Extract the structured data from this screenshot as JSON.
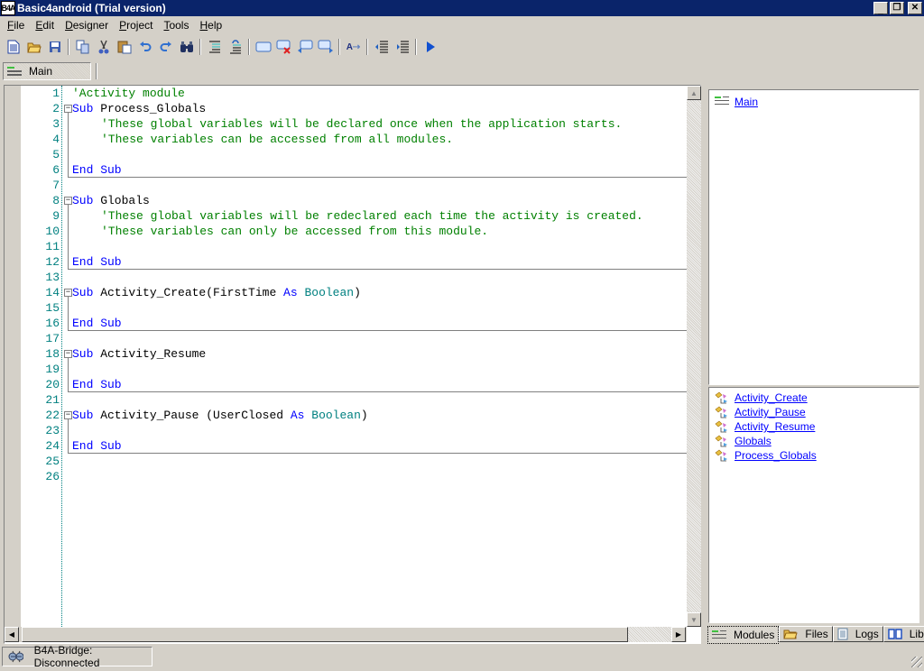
{
  "window": {
    "title": "Basic4android (Trial version)",
    "app_icon_text": "B4A",
    "controls": {
      "minimize": "_",
      "restore": "🗗",
      "close": "✕"
    }
  },
  "menu": [
    {
      "label": "File",
      "accel": "F",
      "rest": "ile"
    },
    {
      "label": "Edit",
      "accel": "E",
      "rest": "dit"
    },
    {
      "label": "Designer",
      "accel": "D",
      "rest": "esigner"
    },
    {
      "label": "Project",
      "accel": "P",
      "rest": "roject"
    },
    {
      "label": "Tools",
      "accel": "T",
      "rest": "ools"
    },
    {
      "label": "Help",
      "accel": "H",
      "rest": "elp"
    }
  ],
  "toolbar": {
    "icons": [
      "new-file",
      "open-folder",
      "save",
      "copy",
      "cut",
      "paste",
      "undo",
      "redo",
      "find",
      "comment",
      "uncomment",
      "bookmark",
      "remove-bookmark",
      "previous-bookmark",
      "next-bookmark",
      "autocomplete",
      "outdent",
      "indent",
      "run"
    ]
  },
  "module_tab": {
    "label": "Main"
  },
  "editor": {
    "lines": [
      {
        "n": "1",
        "parts": [
          {
            "c": "cm",
            "t": "'Activity module"
          }
        ],
        "indent": 0
      },
      {
        "n": "2",
        "parts": [
          {
            "c": "kw",
            "t": "Sub"
          },
          {
            "c": "id",
            "t": " Process_Globals"
          }
        ],
        "indent": 0,
        "fold": true
      },
      {
        "n": "3",
        "parts": [
          {
            "c": "cm",
            "t": "'These global variables will be declared once when the application starts."
          }
        ],
        "indent": 1
      },
      {
        "n": "4",
        "parts": [
          {
            "c": "cm",
            "t": "'These variables can be accessed from all modules."
          }
        ],
        "indent": 1
      },
      {
        "n": "5",
        "parts": [],
        "indent": 1
      },
      {
        "n": "6",
        "parts": [
          {
            "c": "kw",
            "t": "End Sub"
          }
        ],
        "indent": 0,
        "end": true
      },
      {
        "n": "7",
        "parts": [],
        "indent": 0
      },
      {
        "n": "8",
        "parts": [
          {
            "c": "kw",
            "t": "Sub"
          },
          {
            "c": "id",
            "t": " Globals"
          }
        ],
        "indent": 0,
        "fold": true
      },
      {
        "n": "9",
        "parts": [
          {
            "c": "cm",
            "t": "'These global variables will be redeclared each time the activity is created."
          }
        ],
        "indent": 1
      },
      {
        "n": "10",
        "parts": [
          {
            "c": "cm",
            "t": "'These variables can only be accessed from this module."
          }
        ],
        "indent": 1
      },
      {
        "n": "11",
        "parts": [],
        "indent": 1
      },
      {
        "n": "12",
        "parts": [
          {
            "c": "kw",
            "t": "End Sub"
          }
        ],
        "indent": 0,
        "end": true
      },
      {
        "n": "13",
        "parts": [],
        "indent": 0
      },
      {
        "n": "14",
        "parts": [
          {
            "c": "kw",
            "t": "Sub"
          },
          {
            "c": "id",
            "t": " Activity_Create(FirstTime "
          },
          {
            "c": "kw",
            "t": "As"
          },
          {
            "c": "id",
            "t": " "
          },
          {
            "c": "ty",
            "t": "Boolean"
          },
          {
            "c": "id",
            "t": ")"
          }
        ],
        "indent": 0,
        "fold": true
      },
      {
        "n": "15",
        "parts": [],
        "indent": 0
      },
      {
        "n": "16",
        "parts": [
          {
            "c": "kw",
            "t": "End Sub"
          }
        ],
        "indent": 0,
        "end": true
      },
      {
        "n": "17",
        "parts": [],
        "indent": 0
      },
      {
        "n": "18",
        "parts": [
          {
            "c": "kw",
            "t": "Sub"
          },
          {
            "c": "id",
            "t": " Activity_Resume"
          }
        ],
        "indent": 0,
        "fold": true
      },
      {
        "n": "19",
        "parts": [],
        "indent": 0
      },
      {
        "n": "20",
        "parts": [
          {
            "c": "kw",
            "t": "End Sub"
          }
        ],
        "indent": 0,
        "end": true
      },
      {
        "n": "21",
        "parts": [],
        "indent": 0
      },
      {
        "n": "22",
        "parts": [
          {
            "c": "kw",
            "t": "Sub"
          },
          {
            "c": "id",
            "t": " Activity_Pause (UserClosed "
          },
          {
            "c": "kw",
            "t": "As"
          },
          {
            "c": "id",
            "t": " "
          },
          {
            "c": "ty",
            "t": "Boolean"
          },
          {
            "c": "id",
            "t": ")"
          }
        ],
        "indent": 0,
        "fold": true
      },
      {
        "n": "23",
        "parts": [],
        "indent": 0
      },
      {
        "n": "24",
        "parts": [
          {
            "c": "kw",
            "t": "End Sub"
          }
        ],
        "indent": 0,
        "end": true
      },
      {
        "n": "25",
        "parts": [],
        "indent": 0
      },
      {
        "n": "26",
        "parts": [],
        "indent": 0
      }
    ]
  },
  "modules_panel": {
    "modules": [
      {
        "label": "Main"
      }
    ],
    "subs": [
      {
        "label": "Activity_Create"
      },
      {
        "label": "Activity_Pause"
      },
      {
        "label": "Activity_Resume"
      },
      {
        "label": "Globals"
      },
      {
        "label": "Process_Globals"
      }
    ]
  },
  "right_tabs": [
    {
      "label": "Modules",
      "icon": "modules",
      "active": true
    },
    {
      "label": "Files",
      "icon": "folder",
      "active": false
    },
    {
      "label": "Logs",
      "icon": "log",
      "active": false
    },
    {
      "label": "Libs",
      "icon": "book",
      "active": false
    }
  ],
  "status": {
    "bridge": "B4A-Bridge: Disconnected"
  },
  "colors": {
    "titlebar": "#0a246a",
    "keyword": "#0000ff",
    "comment": "#008000",
    "type": "#008080",
    "line_number": "#008080",
    "link": "#0000ff"
  }
}
